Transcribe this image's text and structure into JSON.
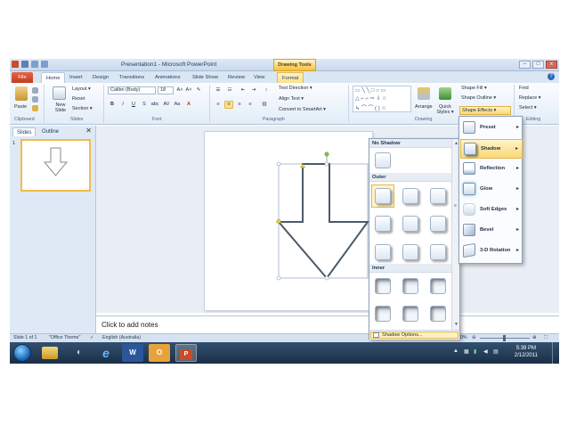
{
  "window": {
    "title": "Presentation1 - Microsoft PowerPoint",
    "context_tab": "Drawing Tools",
    "controls": [
      "–",
      "□",
      "x"
    ]
  },
  "tabs": [
    {
      "label": "File"
    },
    {
      "label": "Home"
    },
    {
      "label": "Insert"
    },
    {
      "label": "Design"
    },
    {
      "label": "Transitions"
    },
    {
      "label": "Animations"
    },
    {
      "label": "Slide Show"
    },
    {
      "label": "Review"
    },
    {
      "label": "View"
    },
    {
      "label": "Format"
    }
  ],
  "ribbon": {
    "clipboard": {
      "paste": "Paste",
      "group": "Clipboard"
    },
    "slides": {
      "new_slide": "New Slide",
      "layout": "Layout ▾",
      "reset": "Reset",
      "section": "Section ▾",
      "group": "Slides"
    },
    "font": {
      "name": "Calibri (Body)",
      "size": "18",
      "group": "Font",
      "bold": "B",
      "italic": "I",
      "underline": "U",
      "strike": "S",
      "shadow": "abc",
      "spacing": "AV",
      "case": "Aa",
      "color": "A"
    },
    "paragraph": {
      "text_direction": "Text Direction ▾",
      "align_text": "Align Text ▾",
      "convert": "Convert to SmartArt ▾",
      "group": "Paragraph"
    },
    "drawing": {
      "arrange": "Arrange",
      "quick_styles": "Quick Styles ▾",
      "shape_fill": "Shape Fill ▾",
      "shape_outline": "Shape Outline ▾",
      "shape_effects": "Shape Effects ▾",
      "group": "Drawing"
    },
    "editing": {
      "find": "Find",
      "replace": "Replace ▾",
      "select": "Select ▾",
      "group": "Editing"
    }
  },
  "panel": {
    "tabs": [
      "Slides",
      "Outline"
    ],
    "close": "✕",
    "slide_number": "1"
  },
  "notes": {
    "placeholder": "Click to add notes"
  },
  "status": {
    "slide": "Slide 1 of 1",
    "theme": "\"Office Theme\"",
    "language": "English (Australia)",
    "zoom": "50%"
  },
  "shadow_gallery": {
    "no_shadow": "No Shadow",
    "outer": "Outer",
    "inner": "Inner",
    "options": "Shadow Options..."
  },
  "effects_menu": [
    {
      "label": "Preset"
    },
    {
      "label": "Shadow"
    },
    {
      "label": "Reflection"
    },
    {
      "label": "Glow"
    },
    {
      "label": "Soft Edges"
    },
    {
      "label": "Bevel"
    },
    {
      "label": "3-D Rotation"
    }
  ],
  "taskbar": {
    "time": "5:39 PM",
    "date": "2/12/2011"
  },
  "colors": {
    "accent": "#f2bb4b",
    "ribbon": "#e3ecf7",
    "taskbar": "#1b2f46",
    "file_tab": "#c23d1b"
  }
}
